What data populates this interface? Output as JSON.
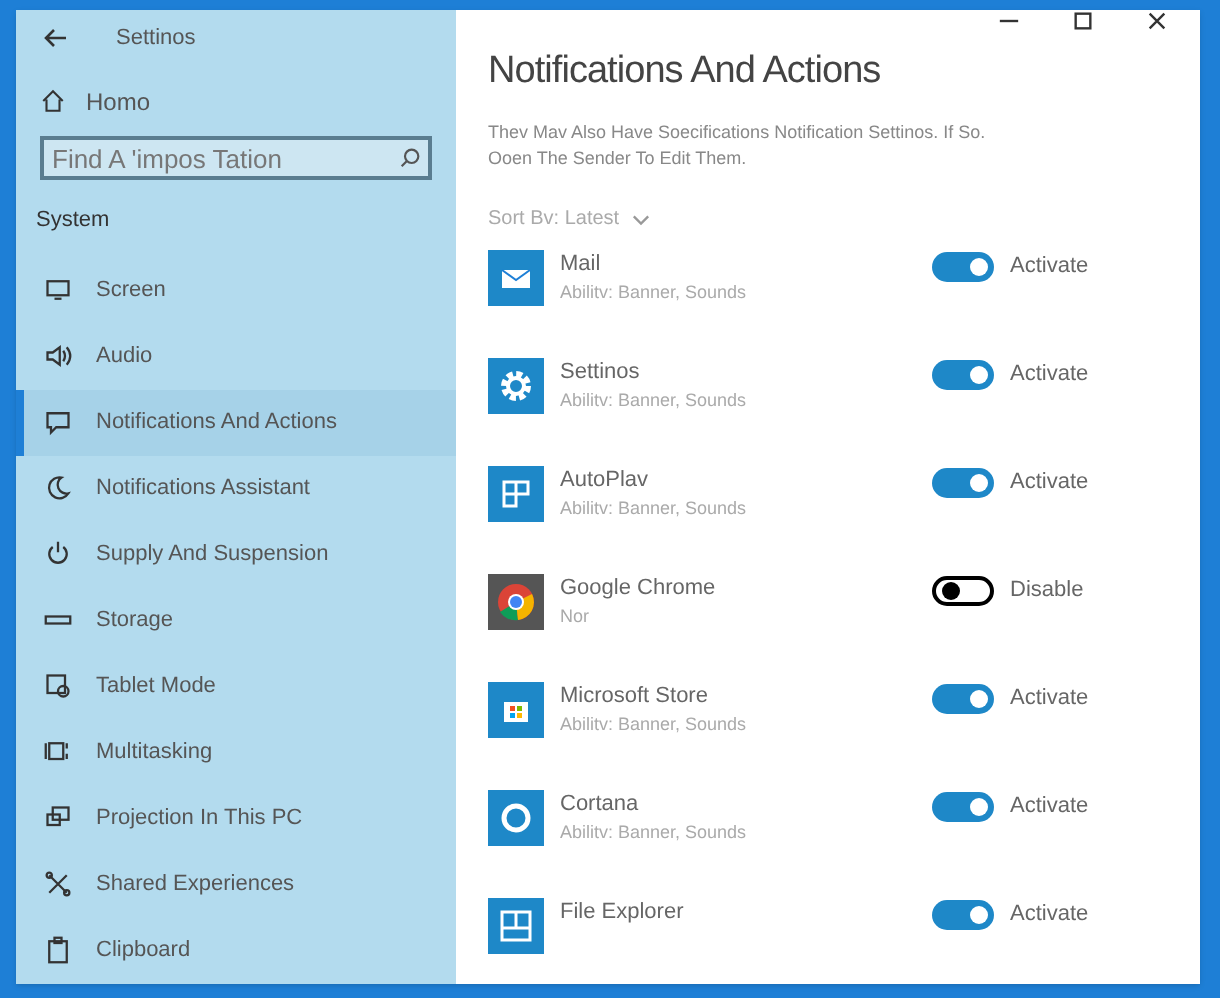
{
  "window": {
    "title": "Settinos"
  },
  "sidebar": {
    "home": "Homo",
    "search": {
      "value": "Find A 'impos Tation"
    },
    "section": "System",
    "items": [
      {
        "label": "Screen",
        "selected": false
      },
      {
        "label": "Audio",
        "selected": false
      },
      {
        "label": "Notifications And Actions",
        "selected": true
      },
      {
        "label": "Notifications Assistant",
        "selected": false
      },
      {
        "label": "Supply And Suspension",
        "selected": false
      },
      {
        "label": "Storage",
        "selected": false
      },
      {
        "label": "Tablet Mode",
        "selected": false
      },
      {
        "label": "Multitasking",
        "selected": false
      },
      {
        "label": "Projection In This PC",
        "selected": false
      },
      {
        "label": "Shared Experiences",
        "selected": false
      },
      {
        "label": "Clipboard",
        "selected": false
      }
    ]
  },
  "content": {
    "title": "Notifications And Actions",
    "description": [
      "Thev Mav Also Have Soecifications Notification Settinos. If So.",
      "Ooen The Sender To Edit Them."
    ],
    "sort": "Sort Bv: Latest",
    "apps": [
      {
        "name": "Mail",
        "detail": "Abilitv: Banner, Sounds",
        "on": true,
        "state": "Activate"
      },
      {
        "name": "Settinos",
        "detail": "Abilitv: Banner, Sounds",
        "on": true,
        "state": "Activate"
      },
      {
        "name": "AutoPlav",
        "detail": "Abilitv: Banner, Sounds",
        "on": true,
        "state": "Activate"
      },
      {
        "name": "Google Chrome",
        "detail": "Nor",
        "on": false,
        "state": "Disable"
      },
      {
        "name": "Microsoft Store",
        "detail": "Abilitv: Banner, Sounds",
        "on": true,
        "state": "Activate"
      },
      {
        "name": "Cortana",
        "detail": "Abilitv: Banner, Sounds",
        "on": true,
        "state": "Activate"
      },
      {
        "name": "File Explorer",
        "on": true,
        "state": "Activate"
      }
    ]
  }
}
